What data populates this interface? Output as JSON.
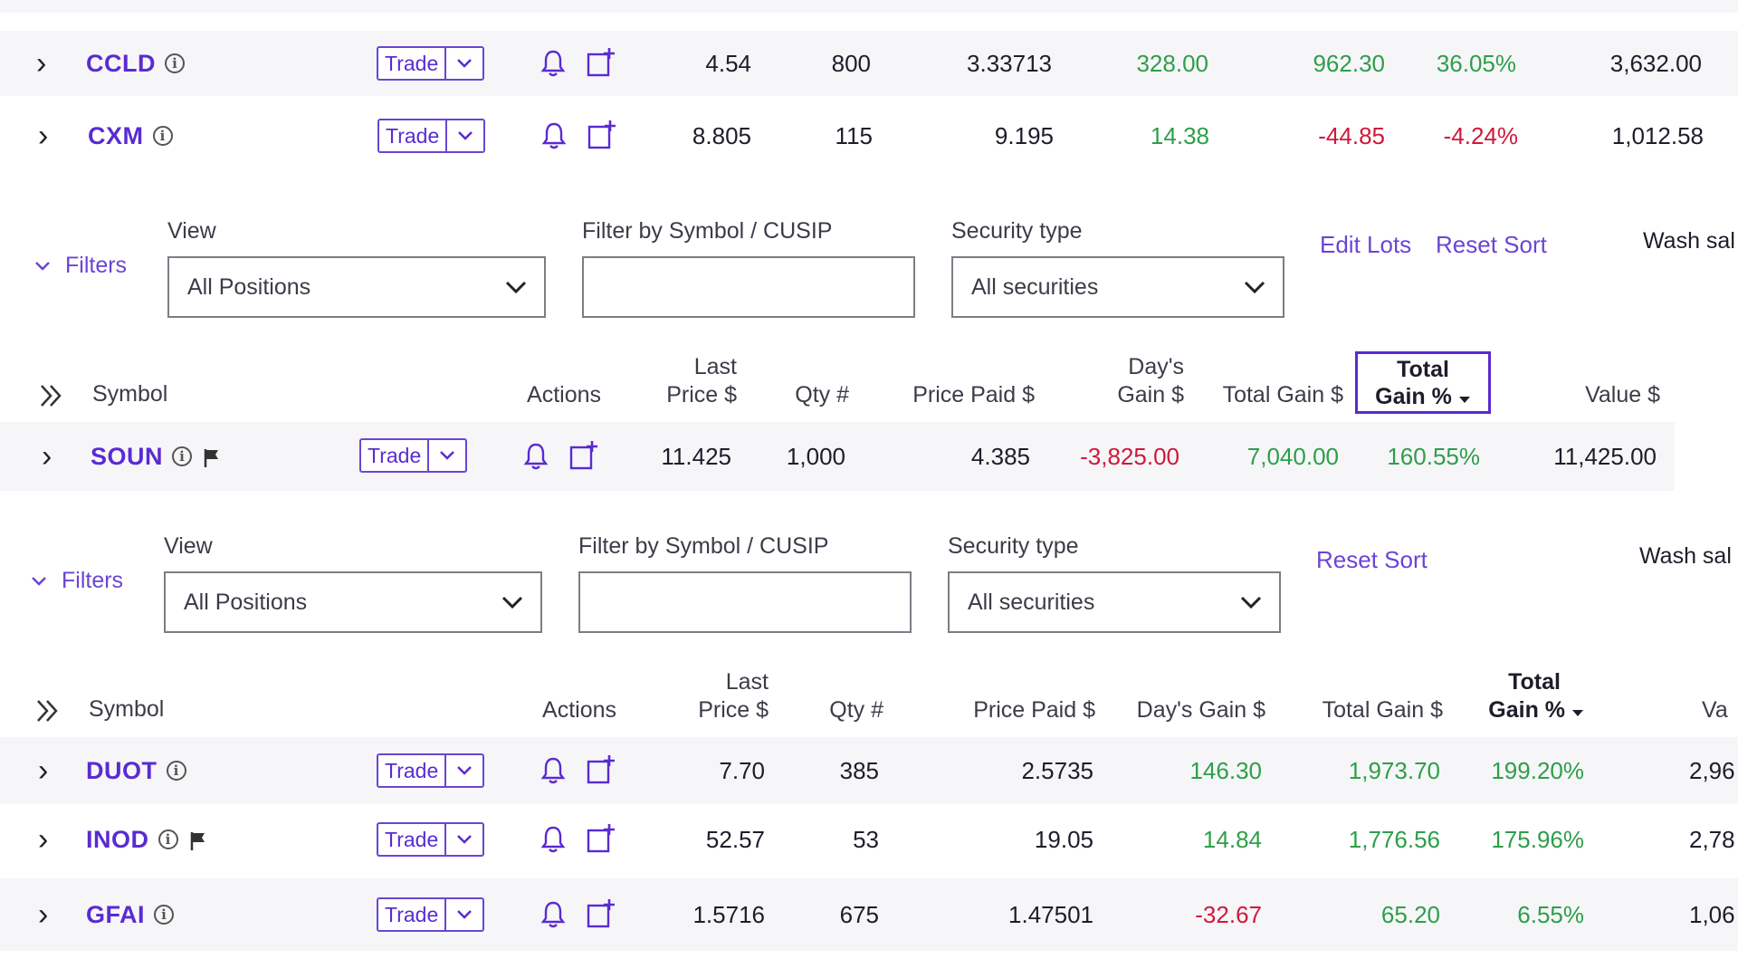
{
  "colors": {
    "accent": "#5a2bd0",
    "gain": "#2e9e4a",
    "loss": "#d0183a"
  },
  "icons": {
    "expand_row": "chevron-right-icon",
    "info": "info-circle-icon",
    "flag": "flag-icon",
    "alert": "bell-icon",
    "add_to_list": "add-to-list-icon",
    "trade_menu": "chevron-down-icon",
    "expand_columns": "double-chevron-right-icon",
    "sort": "caret-down-icon"
  },
  "top_rows": [
    {
      "symbol": "CCLD",
      "trade": "Trade",
      "last_price": "4.54",
      "qty": "800",
      "price_paid": "3.33713",
      "days_gain": "328.00",
      "total_gain": "962.30",
      "total_gain_pct": "36.05%",
      "value": "3,632.00"
    },
    {
      "symbol": "CXM",
      "trade": "Trade",
      "last_price": "8.805",
      "qty": "115",
      "price_paid": "9.195",
      "days_gain": "14.38",
      "total_gain": "-44.85",
      "total_gain_pct": "-4.24%",
      "value": "1,012.58"
    }
  ],
  "filters_a": {
    "toggle_label": "Filters",
    "view_label": "View",
    "view_value": "All Positions",
    "filter_label": "Filter by Symbol / CUSIP",
    "filter_value": "",
    "security_label": "Security type",
    "security_value": "All securities",
    "edit_lots": "Edit Lots",
    "reset_sort": "Reset Sort",
    "wash_sale": "Wash sal"
  },
  "header_a": {
    "symbol": "Symbol",
    "actions": "Actions",
    "last_price_1": "Last",
    "last_price_2": "Price $",
    "qty": "Qty #",
    "price_paid": "Price Paid $",
    "days_gain_1": "Day's",
    "days_gain_2": "Gain $",
    "total_gain": "Total Gain $",
    "total_gain_pct_1": "Total",
    "total_gain_pct_2": "Gain %",
    "value": "Value $"
  },
  "mid_row": {
    "symbol": "SOUN",
    "trade": "Trade",
    "last_price": "11.425",
    "qty": "1,000",
    "price_paid": "4.385",
    "days_gain": "-3,825.00",
    "total_gain": "7,040.00",
    "total_gain_pct": "160.55%",
    "value": "11,425.00"
  },
  "filters_b": {
    "toggle_label": "Filters",
    "view_label": "View",
    "view_value": "All Positions",
    "filter_label": "Filter by Symbol / CUSIP",
    "filter_value": "",
    "security_label": "Security type",
    "security_value": "All securities",
    "reset_sort": "Reset Sort",
    "wash_sale": "Wash sal"
  },
  "header_b": {
    "symbol": "Symbol",
    "actions": "Actions",
    "last_price_1": "Last",
    "last_price_2": "Price $",
    "qty": "Qty #",
    "price_paid": "Price Paid $",
    "days_gain": "Day's Gain $",
    "total_gain": "Total Gain $",
    "total_gain_pct_1": "Total",
    "total_gain_pct_2": "Gain %",
    "value": "Va"
  },
  "bottom_rows": [
    {
      "symbol": "DUOT",
      "trade": "Trade",
      "last_price": "7.70",
      "qty": "385",
      "price_paid": "2.5735",
      "days_gain": "146.30",
      "total_gain": "1,973.70",
      "total_gain_pct": "199.20%",
      "value": "2,96"
    },
    {
      "symbol": "INOD",
      "trade": "Trade",
      "last_price": "52.57",
      "qty": "53",
      "price_paid": "19.05",
      "days_gain": "14.84",
      "total_gain": "1,776.56",
      "total_gain_pct": "175.96%",
      "value": "2,78"
    },
    {
      "symbol": "GFAI",
      "trade": "Trade",
      "last_price": "1.5716",
      "qty": "675",
      "price_paid": "1.47501",
      "days_gain": "-32.67",
      "total_gain": "65.20",
      "total_gain_pct": "6.55%",
      "value": "1,06"
    }
  ]
}
